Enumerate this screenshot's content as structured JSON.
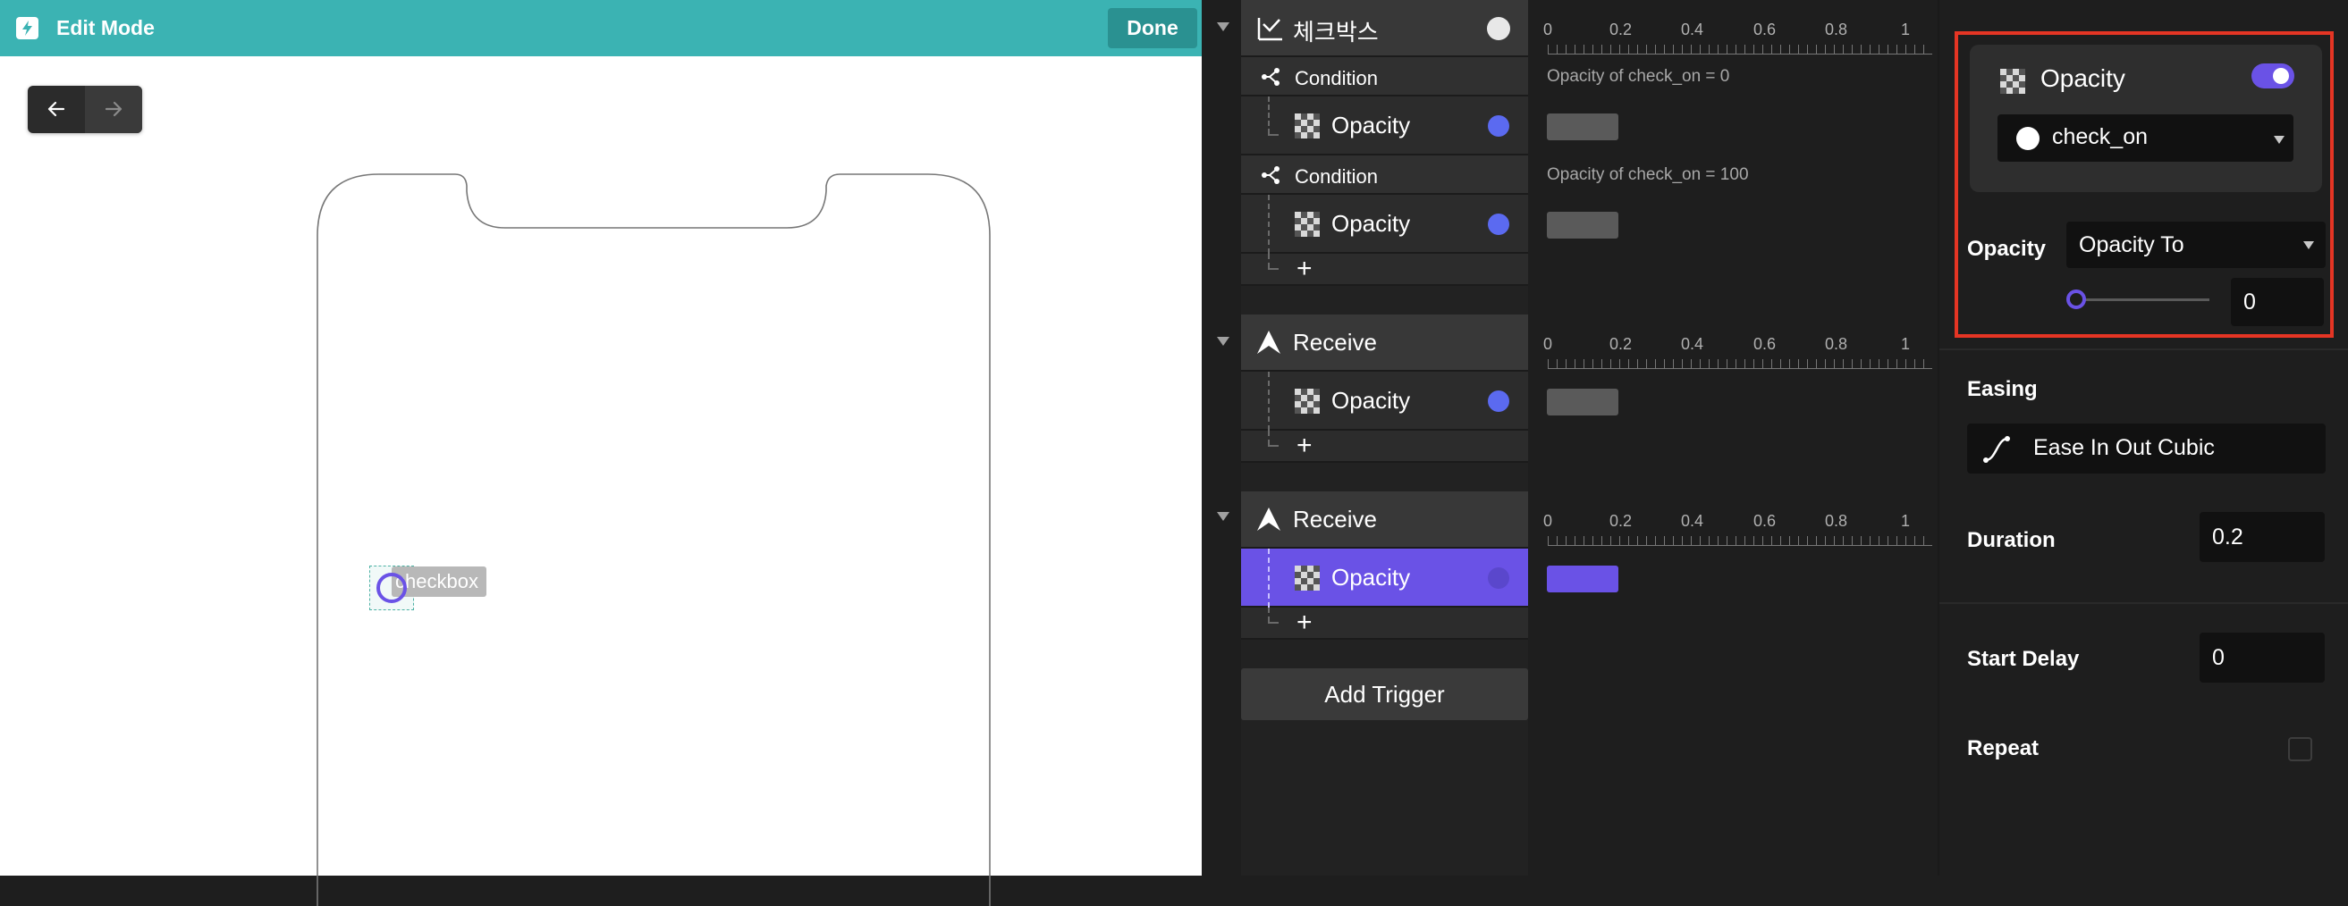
{
  "header": {
    "title": "Edit Mode",
    "done_label": "Done"
  },
  "canvas": {
    "element_label": "checkbox"
  },
  "triggers": {
    "items": [
      {
        "label": "체크박스",
        "conditions": [
          {
            "label": "Condition",
            "note": "Opacity of check_on = 0",
            "action": "Opacity"
          },
          {
            "label": "Condition",
            "note": "Opacity of check_on = 100",
            "action": "Opacity"
          }
        ]
      },
      {
        "label": "Receive",
        "action": "Opacity"
      },
      {
        "label": "Receive",
        "action": "Opacity"
      }
    ],
    "add_label": "+",
    "add_trigger_label": "Add Trigger"
  },
  "timeline": {
    "ticks": [
      "0",
      "0.2",
      "0.4",
      "0.6",
      "0.8",
      "1"
    ]
  },
  "inspector": {
    "card_title": "Opacity",
    "toggle_on": true,
    "target": "check_on",
    "opacity_label": "Opacity",
    "opacity_mode": "Opacity To",
    "opacity_value": "0",
    "easing_label": "Easing",
    "easing_value": "Ease In Out Cubic",
    "duration_label": "Duration",
    "duration_value": "0.2",
    "start_delay_label": "Start Delay",
    "start_delay_value": "0",
    "repeat_label": "Repeat",
    "repeat_checked": false
  },
  "colors": {
    "teal": "#3bb3b3",
    "accent": "#6a52e6",
    "highlight": "#e53524",
    "dot": "#5b6af0"
  }
}
